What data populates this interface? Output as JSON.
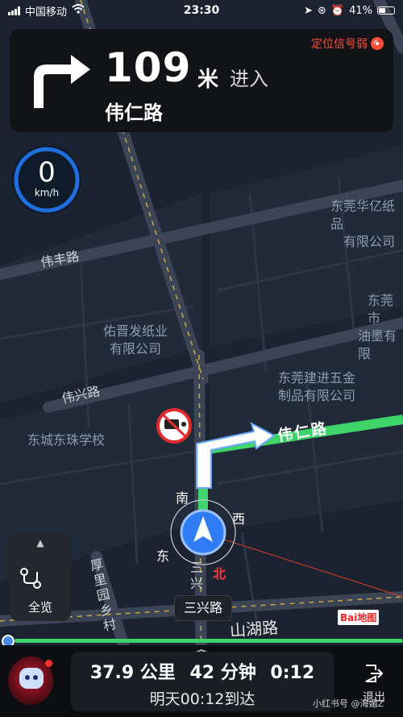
{
  "status_bar": {
    "carrier": "中国移动",
    "time": "23:30",
    "battery": "41%"
  },
  "navigation": {
    "turn": "right",
    "distance": "109",
    "distance_unit": "米",
    "action": "进入",
    "road": "伟仁路",
    "gps_warning": "定位信号弱"
  },
  "speedometer": {
    "value": "0",
    "unit": "km/h"
  },
  "map": {
    "labels": {
      "company1_line1": "东莞华亿纸品",
      "company1_line2": "有限公司",
      "company2_line1": "东莞市",
      "company2_line2": "油墨有限",
      "company3_line1": "佑晋发纸业",
      "company3_line2": "有限公司",
      "company4_line1": "东莞建进五金",
      "company4_line2": "制品有限公司",
      "school": "东城东珠学校"
    },
    "roads": {
      "weifeng": "伟丰路",
      "weixing": "伟兴路",
      "weiren_route": "伟仁路",
      "houjie_vertical": "厚里园乡村",
      "sanxing_vertical": "三兴",
      "shanhu": "山湖路"
    },
    "compass": {
      "north": "北",
      "south": "南",
      "east": "东",
      "west": "西"
    },
    "current_road": "三兴路",
    "logo": "Bai地图"
  },
  "overview_button": {
    "label": "全览"
  },
  "route_progress": 1.0,
  "trip": {
    "distance": "37.9 公里",
    "duration": "42 分钟",
    "eta_time": "0:12",
    "arrival": "明天00:12到达"
  },
  "exit_button": {
    "label": "退出"
  },
  "watermark": "小红书号 @海媚Z",
  "colors": {
    "route": "#3fd46a",
    "accent": "#2f7cf6",
    "warning": "#ff4e3a",
    "north": "#ff3a3a"
  }
}
